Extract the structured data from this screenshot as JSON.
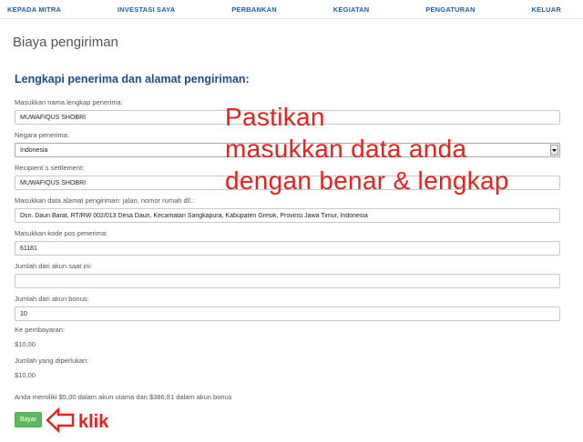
{
  "nav": {
    "items": [
      "KEPADA MITRA",
      "INVESTASI SAYA",
      "PERBANKAN",
      "KEGIATAN",
      "PENGATURAN",
      "KELUAR"
    ]
  },
  "page_title": "Biaya pengiriman",
  "section_heading": "Lengkapi penerima dan alamat pengiriman:",
  "form": {
    "recipient_name": {
      "label": "Masukkan nama lengkap penerima:",
      "value": "MUWAFIQUS SHOBRI"
    },
    "country": {
      "label": "Negara penerima:",
      "value": "Indonesia"
    },
    "settlement": {
      "label": "Recipient`s settlement:",
      "value": "MUWAFIQUS SHOBRI"
    },
    "address": {
      "label": "Masukkan data alamat pengiriman: jalan, nomor rumah dll.:",
      "value": "Dsn. Daun Barat, RT/RW 002/013 Desa Daun, Kecamatan Sangkapura, Kabupaten Gresik, Provinsi Jawa Timur, Indonesia"
    },
    "postal_code": {
      "label": "Masukkan kode pos penerima:",
      "value": "61181"
    },
    "current_account_amount": {
      "label": "Jumlah dari akun saat ini:",
      "value": ""
    },
    "bonus_account_amount": {
      "label": "Jumlah dari akun bonus:",
      "value": "10"
    }
  },
  "summary": {
    "to_pay_label": "Ke pembayaran:",
    "to_pay_value": "$10,00",
    "required_label": "Jumlah yang diperlukan:",
    "required_value": "$10,00",
    "balance_note": "Anda memiliki $5,00 dalam akun utama dan $386,81 dalam akun bonus"
  },
  "pay_button": {
    "label": "Bayar"
  },
  "annotation": {
    "lines": [
      "Pastikan",
      "masukkan data anda",
      "dengan benar & lengkap"
    ],
    "click_hint": "klik"
  },
  "icons": {
    "country_dropdown": "chevron-down-icon",
    "pay_hint_arrow": "left-arrow-icon"
  },
  "colors": {
    "nav": "#2160a6",
    "heading": "#1d4c8d",
    "title": "#555555",
    "label": "#555555",
    "input-text": "#222222",
    "border": "#c9c9c9",
    "button": "#5cb85c",
    "button-border": "#4cae4c",
    "annotation": "#e8201e"
  }
}
